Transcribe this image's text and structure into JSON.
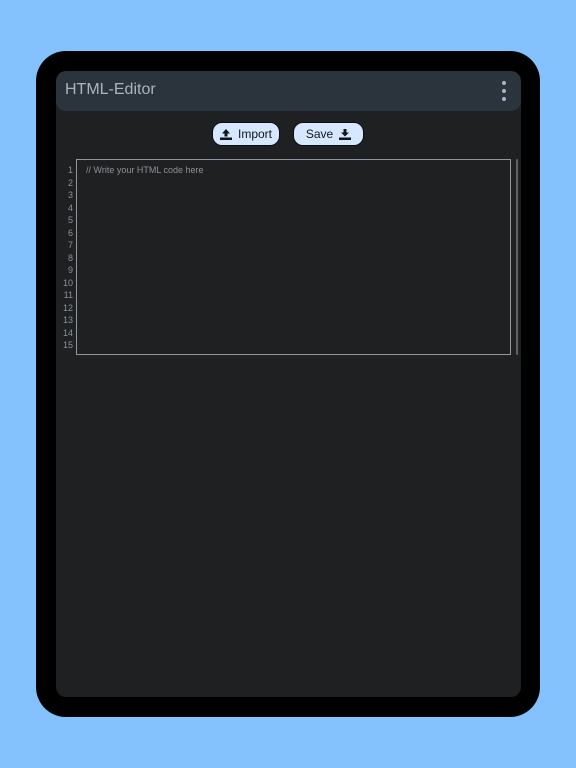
{
  "appbar": {
    "title": "HTML-Editor",
    "menu_icon": "more-vertical-icon"
  },
  "toolbar": {
    "import_label": "Import",
    "import_icon": "upload-icon",
    "save_label": "Save",
    "save_icon": "download-icon"
  },
  "editor": {
    "placeholder": "// Write your HTML code here",
    "line_numbers": [
      "1",
      "2",
      "3",
      "4",
      "5",
      "6",
      "7",
      "8",
      "9",
      "10",
      "11",
      "12",
      "13",
      "14",
      "15"
    ]
  },
  "colors": {
    "background": "#84c2fd",
    "device_frame": "#000000",
    "screen": "#1f2022",
    "appbar": "#2b343d",
    "button": "#d6e8ff"
  }
}
